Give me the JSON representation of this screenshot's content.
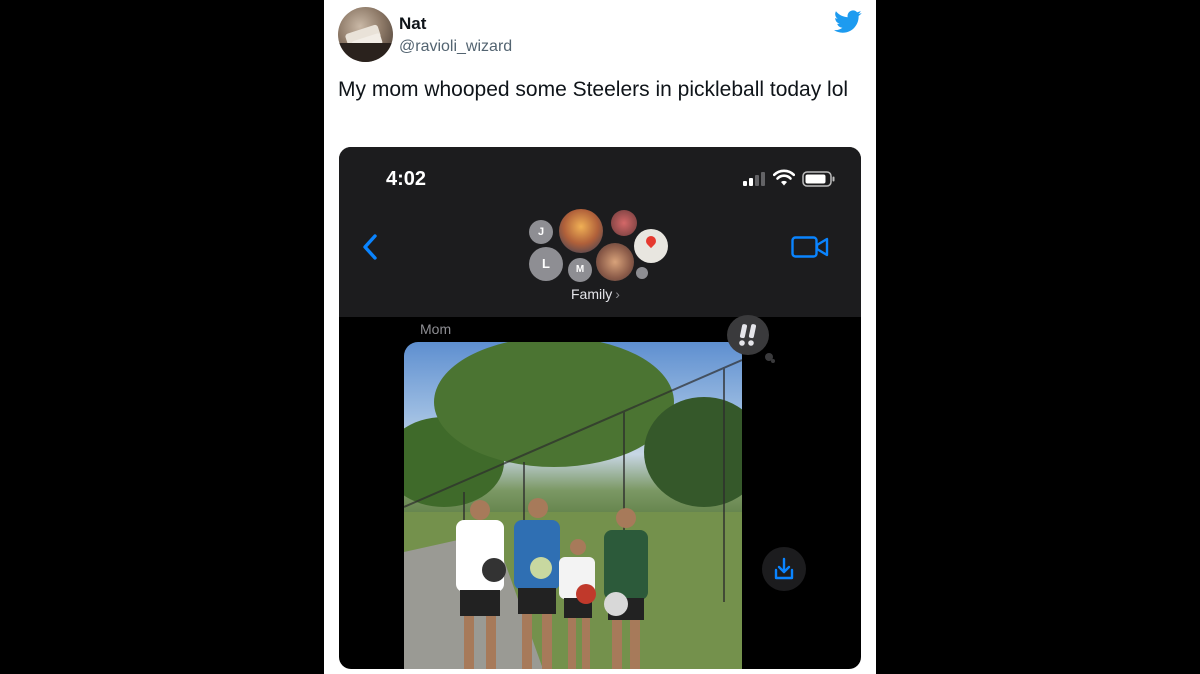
{
  "tweet": {
    "author_name": "Nat",
    "author_handle": "@ravioli_wizard",
    "text": "My mom whooped some Steelers in pickleball today lol"
  },
  "phone": {
    "status_time": "4:02",
    "group_name": "Family",
    "group_chevron": "›",
    "avatars": [
      "J",
      "L",
      "M"
    ],
    "sender_label": "Mom",
    "accent_color": "#0a84ff"
  },
  "icons": {
    "twitter": "twitter-bird-icon",
    "back": "chevron-left-icon",
    "video": "video-camera-icon",
    "save": "download-icon",
    "tapback": "exclamation-tapback-icon"
  }
}
